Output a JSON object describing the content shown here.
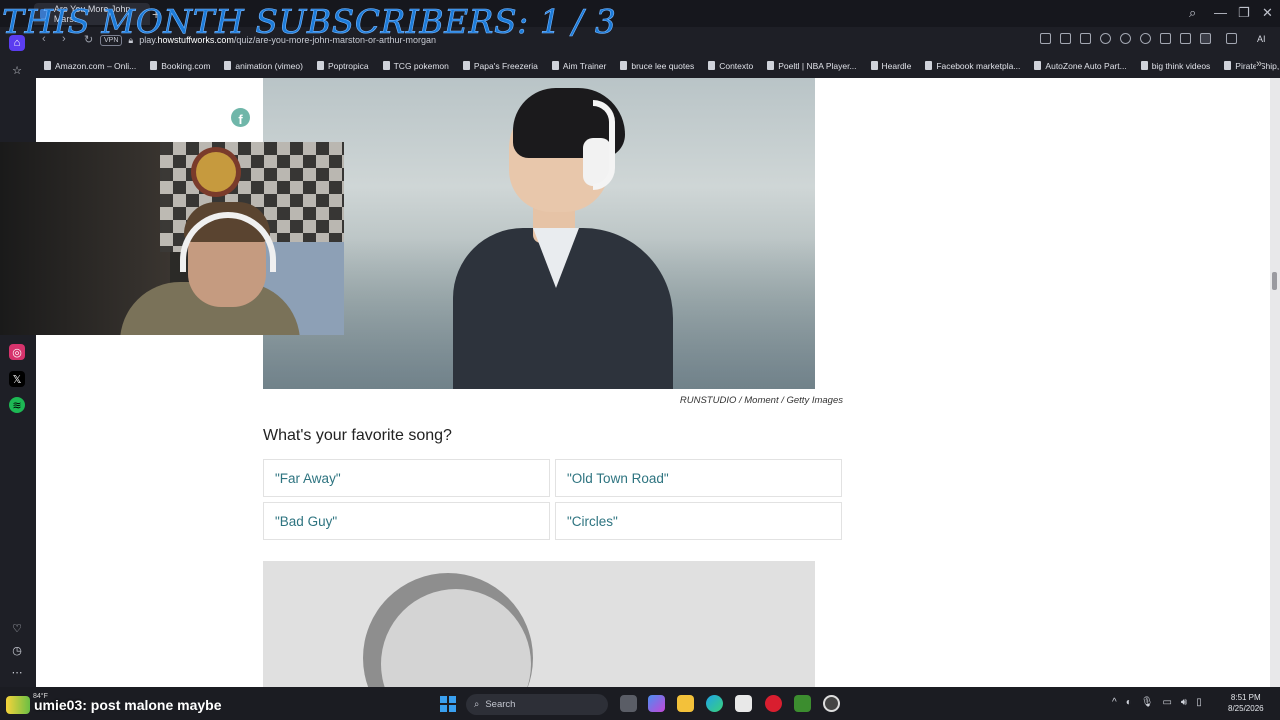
{
  "overlay": {
    "subscriber_text": "THIS MONTH SUBSCRIBERS: 1 / 3"
  },
  "browser": {
    "tab_title": "Are You More John Marst...",
    "new_tab_label": "+",
    "vpn_label": "VPN",
    "url_prefix": "play.",
    "url_domain": "howstuffworks.com",
    "url_path": "/quiz/are-you-more-john-marston-or-arthur-morgan",
    "window_controls": {
      "search": "⌕",
      "minimize": "—",
      "restore": "❐",
      "close": "✕"
    },
    "ai_label": "AI"
  },
  "bookmarks": [
    {
      "label": "Amazon.com – Onli..."
    },
    {
      "label": "Booking.com"
    },
    {
      "label": "animation (vimeo)"
    },
    {
      "label": "Poptropica"
    },
    {
      "label": "TCG pokemon"
    },
    {
      "label": "Papa's Freezeria"
    },
    {
      "label": "Aim Trainer"
    },
    {
      "label": "bruce lee quotes"
    },
    {
      "label": "Contexto"
    },
    {
      "label": "Poeltl | NBA Player..."
    },
    {
      "label": "Heardle"
    },
    {
      "label": "Facebook marketpla..."
    },
    {
      "label": "AutoZone Auto Part..."
    },
    {
      "label": "big think videos"
    },
    {
      "label": "Pirate Ship, ship pa..."
    }
  ],
  "bookmarks_more": "»",
  "page": {
    "facebook_icon": "f",
    "image_caption": "RUNSTUDIO / Moment / Getty Images",
    "question": "What's your favorite song?",
    "answers": [
      "\"Far Away\"",
      "\"Old Town Road\"",
      "\"Bad Guy\"",
      "\"Circles\""
    ]
  },
  "taskbar": {
    "weather": "84°F",
    "chat_user": "umie03",
    "chat_message": ": post malone maybe",
    "search_placeholder": "Search",
    "time": "8:51 PM",
    "date": "8/25/2026",
    "tray_chevron": "^"
  },
  "colors": {
    "answer_text": "#2e7480",
    "accent": "#1c7bd8"
  }
}
